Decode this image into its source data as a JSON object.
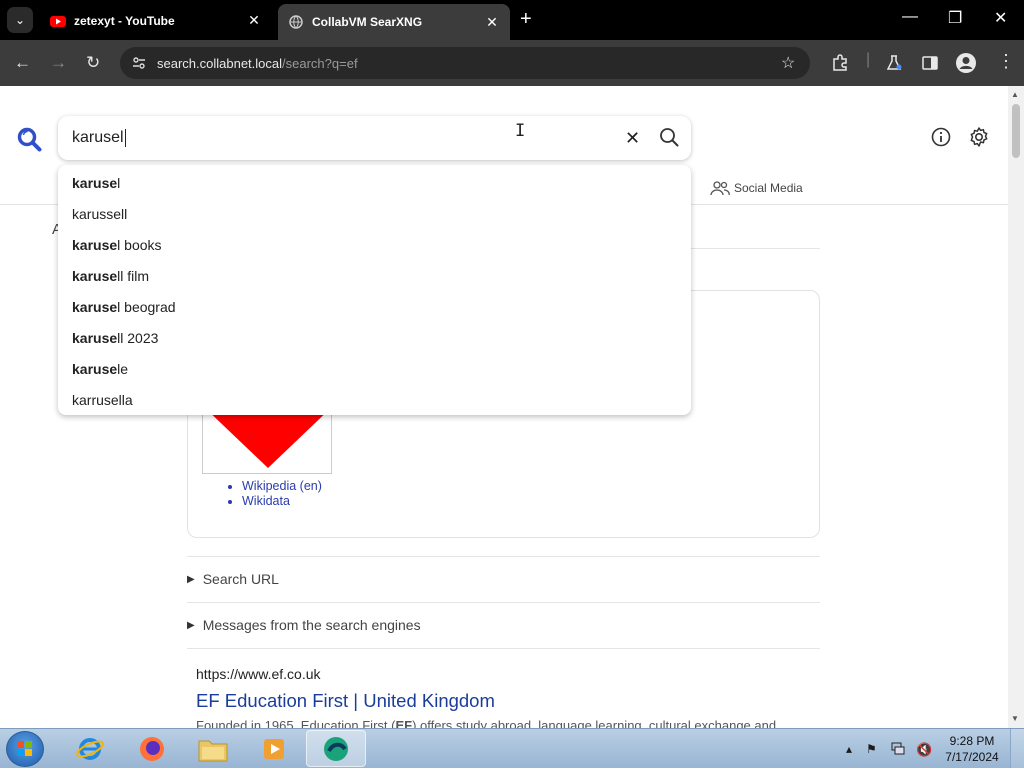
{
  "browser": {
    "tabs": [
      {
        "title": "zetexyt - YouTube",
        "close": "✕"
      },
      {
        "title": "CollabVM SearXNG",
        "close": "✕"
      }
    ],
    "new_tab": "+",
    "window_controls": {
      "minimize": "—",
      "restore": "❐",
      "close": "✕"
    },
    "address": {
      "host": "search.collabnet.local",
      "path": "/search?q=ef"
    }
  },
  "search": {
    "query": "karusel",
    "social_media_label": "Social Media",
    "suggestions": [
      {
        "bold": "karuse",
        "rest": "l"
      },
      {
        "bold": "",
        "rest": "karussell"
      },
      {
        "bold": "karuse",
        "rest": "l books"
      },
      {
        "bold": "karuse",
        "rest": "ll film"
      },
      {
        "bold": "karuse",
        "rest": "l beograd"
      },
      {
        "bold": "karuse",
        "rest": "ll 2023"
      },
      {
        "bold": "karuse",
        "rest": "le"
      },
      {
        "bold": "",
        "rest": "karrusella"
      }
    ]
  },
  "page": {
    "edge_letter": "A",
    "infobox_links": [
      "Wikipedia (en)",
      "Wikidata"
    ],
    "search_url_label": "Search URL",
    "messages_label": "Messages from the search engines",
    "result": {
      "url": "https://www.ef.co.uk",
      "title": "EF Education First | United Kingdom",
      "desc_before": "Founded in 1965, Education First (",
      "desc_bold": "EF",
      "desc_after": ") offers study abroad, language learning, cultural exchange and"
    }
  },
  "taskbar": {
    "time": "9:28 PM",
    "date": "7/17/2024"
  },
  "colors": {
    "accent": "#3050c8",
    "link": "#1a3d9b"
  }
}
